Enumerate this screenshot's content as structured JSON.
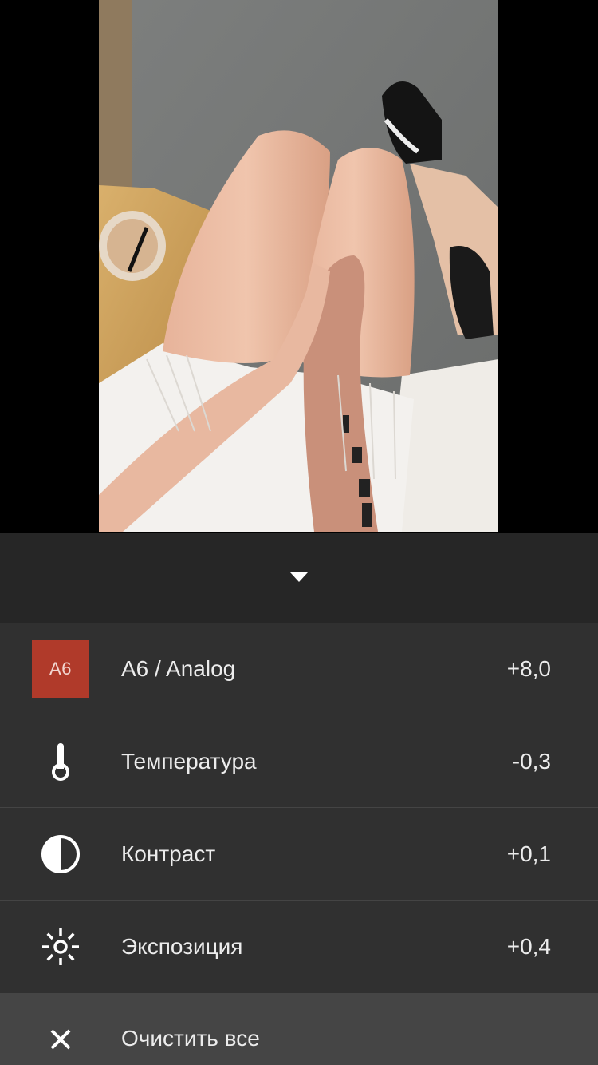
{
  "photo": {
    "description_icon": "photo-preview"
  },
  "panel": {
    "collapse_icon": "caret-down-icon"
  },
  "edits": [
    {
      "icon": "preset-badge",
      "badge": "A6",
      "label": "A6 / Analog",
      "value": "+8,0"
    },
    {
      "icon": "thermometer-icon",
      "label": "Температура",
      "value": "-0,3"
    },
    {
      "icon": "contrast-icon",
      "label": "Контраст",
      "value": "+0,1"
    },
    {
      "icon": "exposure-icon",
      "label": "Экспозиция",
      "value": "+0,4"
    }
  ],
  "clear": {
    "icon": "close-icon",
    "label": "Очистить все"
  },
  "colors": {
    "preset_badge": "#b03a2a",
    "panel_bg": "#303030",
    "collapse_bg": "#262626",
    "clear_bg": "#454545",
    "text": "#ececec"
  }
}
